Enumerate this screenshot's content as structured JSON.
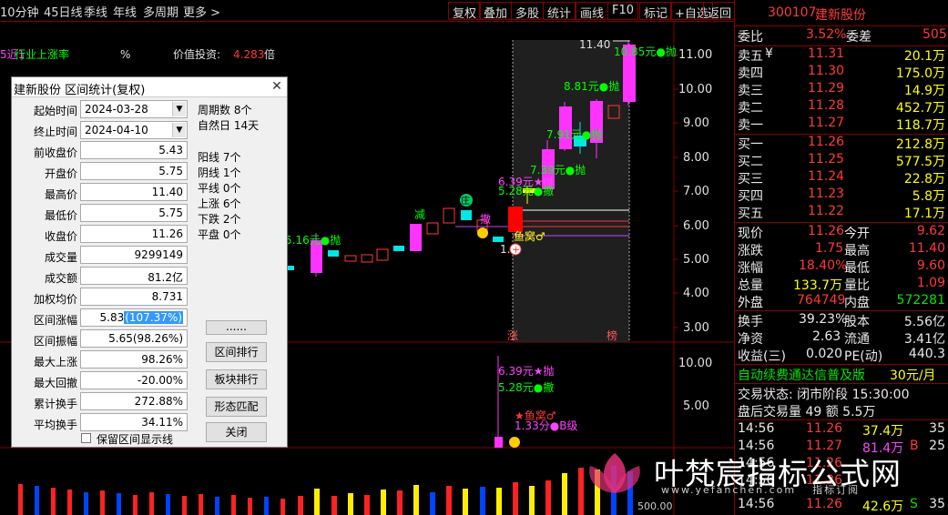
{
  "toolbar": {
    "period_left": "10分钟",
    "items": [
      "45日线",
      "季线",
      "年线",
      "多周期",
      "更多 >"
    ],
    "buttons": [
      "复权",
      "叠加",
      "多股",
      "统计",
      "画线",
      "F10",
      "标记",
      "+自选",
      "返回"
    ]
  },
  "chart_top": {
    "indicator_a": "行业上涨率",
    "indicator_b": "%",
    "value_label": "价值投资:",
    "value_num": "4.283",
    "value_unit": "倍",
    "top_high_label": "11.40",
    "labels": [
      "10.85元●抛",
      "8.81元●抛",
      "7.91元●抛",
      "7.39元●抛",
      "6.39元★抛",
      "5.28元●撤",
      "5.16元●抛",
      "减",
      "庄",
      "撤",
      "鱼窝♂",
      "1.7"
    ],
    "price_axis": [
      "11.00",
      "10.00",
      "9.00",
      "8.00",
      "7.00",
      "6.00",
      "5.00",
      "4.00",
      "3.00"
    ],
    "bottom_tags": [
      "涨",
      "榜"
    ]
  },
  "chart_mid": {
    "price_axis": [
      "10.00",
      "5.00"
    ],
    "labels": [
      "6.39元★抛",
      "5.28元●撤",
      "★鱼窝♂",
      "1.33分●B级"
    ]
  },
  "chart_bottom": {
    "vol_label": "500.00"
  },
  "dialog": {
    "title": "建新股份 区间统计(复权)",
    "start_label": "起始时间",
    "start_value": "2024-03-28",
    "end_label": "终止时间",
    "end_value": "2024-04-10",
    "rows": [
      {
        "label": "前收盘价",
        "value": "5.43"
      },
      {
        "label": "开盘价",
        "value": "5.75"
      },
      {
        "label": "最高价",
        "value": "11.40"
      },
      {
        "label": "最低价",
        "value": "5.75"
      },
      {
        "label": "收盘价",
        "value": "11.26"
      },
      {
        "label": "成交量",
        "value": "9299149"
      },
      {
        "label": "成交额",
        "value": "81.2亿"
      },
      {
        "label": "加权均价",
        "value": "8.731"
      },
      {
        "label": "区间涨幅",
        "value": "5.83",
        "value_hl": "(107.37%)"
      },
      {
        "label": "区间振幅",
        "value": "5.65(98.26%)"
      },
      {
        "label": "最大上涨",
        "value": "98.26%"
      },
      {
        "label": "最大回撤",
        "value": "-20.00%"
      },
      {
        "label": "累计换手",
        "value": "272.88%"
      },
      {
        "label": "平均换手",
        "value": "34.11%"
      }
    ],
    "stats": [
      "周期数 8个",
      "自然日 14天",
      "阳线 7个",
      "阴线 1个",
      "平线 0个",
      "上涨 6个",
      "下跌 2个",
      "平盘 0个"
    ],
    "buttons": [
      "......",
      "区间排行",
      "板块排行",
      "形态匹配",
      "关闭"
    ],
    "checkbox_label": "保留区间显示线"
  },
  "rpanel": {
    "code": "300107",
    "name": "建新股份",
    "weibi_label": "委比",
    "weibi": "3.52%",
    "weicha_label": "委差",
    "weicha": "505",
    "asks": [
      {
        "label": "卖五",
        "mark": "¥",
        "price": "11.31",
        "vol": "20.1万"
      },
      {
        "label": "卖四",
        "mark": "",
        "price": "11.30",
        "vol": "175.0万"
      },
      {
        "label": "卖三",
        "mark": "",
        "price": "11.29",
        "vol": "14.9万"
      },
      {
        "label": "卖二",
        "mark": "",
        "price": "11.28",
        "vol": "452.7万"
      },
      {
        "label": "卖一",
        "mark": "",
        "price": "11.27",
        "vol": "118.7万"
      }
    ],
    "bids": [
      {
        "label": "买一",
        "price": "11.26",
        "vol": "212.8万"
      },
      {
        "label": "买二",
        "price": "11.25",
        "vol": "577.5万"
      },
      {
        "label": "买三",
        "price": "11.24",
        "vol": "22.8万"
      },
      {
        "label": "买四",
        "price": "11.23",
        "vol": "5.8万"
      },
      {
        "label": "买五",
        "price": "11.22",
        "vol": "17.1万"
      }
    ],
    "quote": [
      {
        "l1": "现价",
        "v1": "11.26",
        "l2": "今开",
        "v2": "9.62"
      },
      {
        "l1": "涨跌",
        "v1": "1.75",
        "l2": "最高",
        "v2": "11.40"
      },
      {
        "l1": "涨幅",
        "v1": "18.40%",
        "l2": "最低",
        "v2": "9.60"
      },
      {
        "l1": "总量",
        "v1": "133.7万",
        "l2": "量比",
        "v2": "1.09"
      },
      {
        "l1": "外盘",
        "v1": "764749",
        "l2": "内盘",
        "v2": "572281"
      }
    ],
    "fin": [
      {
        "l1": "换手",
        "v1": "39.23%",
        "l2": "股本",
        "v2": "5.56亿"
      },
      {
        "l1": "净资",
        "v1": "2.63",
        "l2": "流通",
        "v2": "3.41亿"
      },
      {
        "l1": "收益(三)",
        "v1": "0.020",
        "l2": "PE(动)",
        "v2": "440.3"
      }
    ],
    "promo": "自动续费通达信普及版",
    "promo_price": "30元/月",
    "trade_state": "交易状态: 闭市阶段 15:30:00",
    "after_hours": "盘后交易量 49 额 5.5万",
    "ticks": [
      {
        "t": "14:56",
        "p": "11.26",
        "v": "37.4万",
        "n": "35",
        "bs": ""
      },
      {
        "t": "14:56",
        "p": "11.27",
        "v": "81.4万",
        "n": "25",
        "bs": "B"
      },
      {
        "t": "14:56",
        "p": "11.26",
        "v": "",
        "n": "",
        "bs": ""
      },
      {
        "t": "14:56",
        "p": "11.26",
        "v": "",
        "n": "",
        "bs": ""
      },
      {
        "t": "14:56",
        "p": "11.26",
        "v": "42.6万",
        "n": "35",
        "bs": "S"
      }
    ]
  },
  "watermark": {
    "title": "叶梵宸指标公式网",
    "sub": "www.yefanchen.com",
    "sub2": "指标订阅"
  }
}
